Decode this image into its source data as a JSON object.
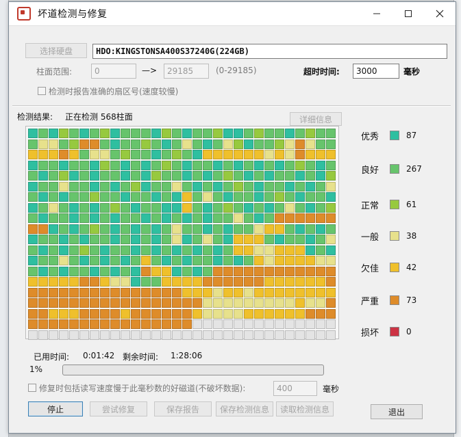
{
  "window": {
    "title": "坏道检测与修复"
  },
  "controls": {
    "select_disk_label": "选择硬盘",
    "disk_info": "HDO:KINGSTONSA400S37240G(224GB)",
    "cylinder_range_label": "柱面范围:",
    "range_start": "0",
    "arrow": "—>",
    "range_end": "29185",
    "range_hint": "(0-29185)",
    "timeout_label": "超时时间:",
    "timeout_value": "3000",
    "timeout_unit": "毫秒",
    "report_sector_label": "检测时报告准确的扇区号(速度较慢)"
  },
  "result": {
    "status_label": "检测结果:",
    "status_text": "正在检测 568柱面",
    "detail_button": "详细信息"
  },
  "legend": [
    {
      "name": "优秀",
      "count": "87",
      "color": "#2fbfa0"
    },
    {
      "name": "良好",
      "count": "267",
      "color": "#67c46c"
    },
    {
      "name": "正常",
      "count": "61",
      "color": "#97c93f"
    },
    {
      "name": "一般",
      "count": "38",
      "color": "#e7e18c"
    },
    {
      "name": "欠佳",
      "count": "42",
      "color": "#efc02c"
    },
    {
      "name": "严重",
      "count": "73",
      "color": "#de8c2a"
    },
    {
      "name": "损坏",
      "count": "0",
      "color": "#cc3344"
    }
  ],
  "timing": {
    "elapsed_label": "已用时间:",
    "elapsed_value": "0:01:42",
    "remaining_label": "剩余时间:",
    "remaining_value": "1:28:06"
  },
  "progress": {
    "percent_label": "1%",
    "fraction": 0.0
  },
  "repair_option": {
    "label": "修复时包括读写速度慢于此毫秒数的好磁道(不破坏数据):",
    "value": "400",
    "unit": "毫秒"
  },
  "buttons": {
    "stop": "停止",
    "try_repair": "尝试修复",
    "save_report": "保存报告",
    "save_info": "保存检测信息",
    "load_info": "读取检测信息",
    "exit": "退出"
  },
  "grid": {
    "cols": 30,
    "rows": 20,
    "rows_data": [
      "BGBCGBGCBGGGBCGBGGCBBGCGGBGCGG",
      "GDDGCFFGBGGCGBGDGBGDCBGGCDFDGG",
      "EEEFEGDDGCGGBGCGBEEEEEEDEDFEEE",
      "BGGBGGBCGBGBGCGBGGBGBGBGBGCGBG",
      "GBGCBGBGGBGBCGGBGBGCGBGBGGBGBC",
      "BGGDGGBGBGCBGGDGBGBGCGBGGBGBGD",
      "GBGBGGCGGBGGBGBEGDGBGGBGCGBGGB",
      "BGDGBGBGCGBGGBBEGBGCGBGBGDGBGC",
      "GBGGBGBGBGGBGBGBGBGGDGBGFFFFFF",
      "FFBGBGCGBGBGBGDGGBGBGGDEEGBGBG",
      "BGGBGBGGBGBGBGDBGDGBEEEGBGGBGD",
      "GBGBGCGBGGBGBGBGBGBGEEDDEEEBGB",
      "BGGDGBGBGBGEGBGBGGBGBGEDEEEEDD",
      "GBGBGGBGBGBFEEBGBGFFFFFFFFFFFF",
      "EEEEEFFEDDBGGEEEEFFFFFFEEEEEEF",
      "FFFFFFFFFFFFFFFEEEDEEDEEEEEEEE",
      "FFFFFFFFFFFFFFFFFDDDDDDDDDEDDF",
      "FFEEEFFFFEFFFFFFEDDDDEEEEEEFFF",
      "FFFFFFFFFFFFFFFFWWWWWWWWWWWWWW",
      "WWWWWWWWWWWWWWWWWWWWWWWWWWWWWW"
    ],
    "colors": {
      "B": "#2fbfa0",
      "G": "#67c46c",
      "C": "#97c93f",
      "D": "#e7e18c",
      "E": "#efc02c",
      "F": "#de8c2a",
      "W": "#e4e4e4"
    }
  }
}
